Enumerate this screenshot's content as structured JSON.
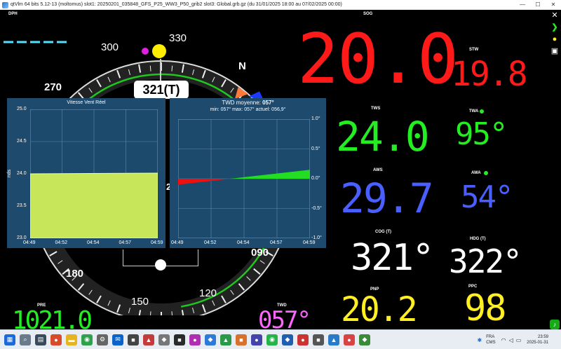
{
  "window": {
    "title": "qtVlm 64 bits 5.12-13 (moltomus) slot1: 20250201_035848_GFS_P25_WW3_P50_grib2 slot3: Global.grb.gz (du 31/01/2025 18:00 au 07/02/2025 00:00)"
  },
  "instruments": {
    "dpt_label": "DPH",
    "sog_label": "SOG",
    "sog_value": "20.0",
    "stw_label": "STW",
    "stw_value": "19.8",
    "tws_label": "TWS",
    "tws_value": "24.0",
    "twa_label": "TWA",
    "twa_value": "95°",
    "aws_label": "AWS",
    "aws_value": "29.7",
    "awa_label": "AWA",
    "awa_value": "54°",
    "cog_label": "COG (T)",
    "cog_value": "321°",
    "hdg_label": "HDG (T)",
    "hdg_value": "322°",
    "pnp_label": "PNP",
    "pnp_value": "20.2",
    "ppc_label": "PPC",
    "ppc_value": "98",
    "pre_label": "PRE",
    "pre_value": "1021.0",
    "twd_label": "TWD",
    "twd_value": "057°"
  },
  "compass": {
    "heading_readout": "321(T)",
    "north": "N",
    "labels": [
      "300",
      "330",
      "270",
      "090",
      "180",
      "150",
      "120"
    ],
    "partial_label": "2"
  },
  "tws_chart": {
    "title": "Vitesse Vent Réel",
    "ylabel": "nds",
    "yticks": [
      "25.0",
      "24.5",
      "24.0",
      "23.5",
      "23.0"
    ],
    "xticks": [
      "04:49",
      "04:52",
      "04:54",
      "04:57",
      "04:59"
    ]
  },
  "twd_chart": {
    "title_prefix": "TWD moyenne:",
    "title_value": "057°",
    "stats": "min: 057° max: 057° actuel: 056,9°",
    "yticks": [
      "1.0°",
      "0.5°",
      "0.0°",
      "-0.5°",
      "-1.0°"
    ],
    "xticks": [
      "04:49",
      "04:52",
      "04:54",
      "04:57",
      "04:59"
    ]
  },
  "chart_data": [
    {
      "type": "area",
      "title": "Vitesse Vent Réel",
      "ylabel": "nds",
      "x": [
        "04:49",
        "04:59"
      ],
      "values": [
        24.0,
        24.0
      ],
      "ylim": [
        23.0,
        25.0
      ],
      "grid": true
    },
    {
      "type": "area",
      "title": "TWD moyenne: 057°",
      "x": [
        "04:49",
        "04:59"
      ],
      "values": [
        -0.1,
        0.15
      ],
      "ylim": [
        -1.0,
        1.0
      ],
      "grid": true
    }
  ],
  "taskbar": {
    "lang1": "FRA",
    "lang2": "CMS",
    "time": "23:59",
    "date": "2025-01-31"
  },
  "colors": {
    "sog": "#ff1a1a",
    "tws": "#22ee22",
    "aws": "#4a5fff",
    "awa": "#4a5fff",
    "cog": "#ffffff",
    "pnp": "#ffee22",
    "twd": "#ff66ff"
  }
}
